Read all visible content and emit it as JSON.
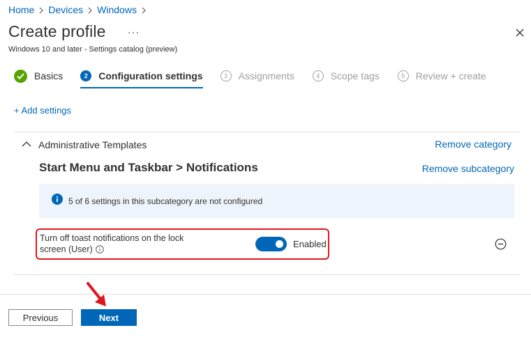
{
  "breadcrumb": [
    "Home",
    "Devices",
    "Windows"
  ],
  "header": {
    "title": "Create profile",
    "more": "···",
    "subtitle": "Windows 10 and later - Settings catalog (preview)"
  },
  "steps": [
    {
      "num": "",
      "label": "Basics",
      "state": "done"
    },
    {
      "num": "2",
      "label": "Configuration settings",
      "state": "active"
    },
    {
      "num": "3",
      "label": "Assignments",
      "state": "pending"
    },
    {
      "num": "4",
      "label": "Scope tags",
      "state": "pending"
    },
    {
      "num": "5",
      "label": "Review + create",
      "state": "pending"
    }
  ],
  "add_settings": "+ Add settings",
  "category": {
    "label": "Administrative Templates",
    "remove": "Remove category",
    "subcategory": "Start Menu and Taskbar > Notifications",
    "remove_sub": "Remove subcategory",
    "info": "5 of 6 settings in this subcategory are not configured"
  },
  "setting": {
    "label": "Turn off toast notifications on the lock screen (User)",
    "toggle_state": "Enabled"
  },
  "footer": {
    "previous": "Previous",
    "next": "Next"
  },
  "colors": {
    "accent": "#0067b8",
    "success": "#57a300",
    "highlight": "#e0161c"
  },
  "icons": {
    "chevron": "chevron-right-icon",
    "close": "close-icon",
    "check": "checkmark-icon",
    "collapse": "chevron-up-icon",
    "info": "info-icon",
    "remove": "remove-circle-icon",
    "arrow": "red-arrow-icon"
  }
}
